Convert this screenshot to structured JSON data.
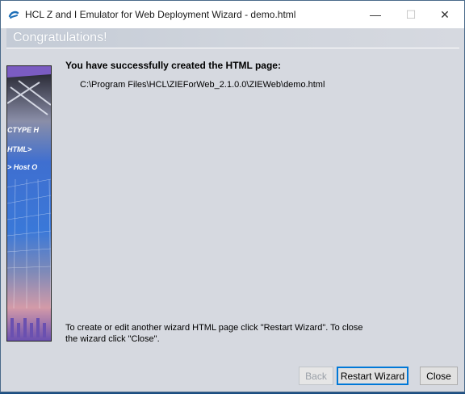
{
  "window": {
    "title": "HCL Z and I Emulator for Web Deployment Wizard - demo.html",
    "controls": {
      "minimize": "—",
      "maximize": "☐",
      "close": "✕"
    }
  },
  "banner": {
    "title": "Congratulations!"
  },
  "content": {
    "heading": "You have successfully created the HTML page:",
    "path": "C:\\Program Files\\HCL\\ZIEForWeb_2.1.0.0\\ZIEWeb\\demo.html",
    "note": "To create or edit another wizard HTML page click \"Restart Wizard\".  To close the wizard click \"Close\"."
  },
  "sidebar_image_text": [
    "CTYPE H",
    "HTML>",
    "> Host O"
  ],
  "buttons": {
    "back": "Back",
    "restart": "Restart Wizard",
    "close": "Close"
  },
  "colors": {
    "window_bg": "#d6d9e0",
    "focus_border": "#0078d7",
    "desktop": "#1c4f83"
  }
}
